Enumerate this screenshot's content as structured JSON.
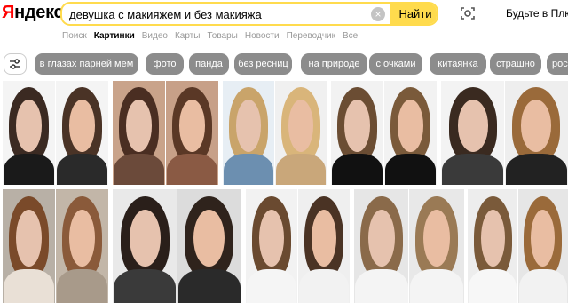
{
  "brand": {
    "logo_y": "Я",
    "logo_rest": "ндекс"
  },
  "search": {
    "query": "девушка с макияжем и без макияжа",
    "clear_label": "×",
    "button_label": "Найти"
  },
  "header": {
    "login_label": "Будьте в Плюсе"
  },
  "tabs": [
    {
      "label": "Поиск"
    },
    {
      "label": "Картинки",
      "active": true
    },
    {
      "label": "Видео"
    },
    {
      "label": "Карты"
    },
    {
      "label": "Товары"
    },
    {
      "label": "Новости"
    },
    {
      "label": "Переводчик"
    },
    {
      "label": "Все"
    }
  ],
  "chips": [
    {
      "label": "в глазах парней мем"
    },
    {
      "label": "фото"
    },
    {
      "label": "панда"
    },
    {
      "label": "без ресниц"
    },
    {
      "label": "на природе"
    },
    {
      "label": "с очками"
    },
    {
      "label": "китаянка"
    },
    {
      "label": "страшно"
    },
    {
      "label": "рос"
    }
  ],
  "colors": {
    "accent": "#ffdb4d",
    "logo_red": "#ff0000",
    "chip_bg": "#8c8c8c"
  },
  "icons": {
    "filter": "sliders-icon",
    "camera": "camera-search-icon",
    "clear": "clear-icon"
  }
}
